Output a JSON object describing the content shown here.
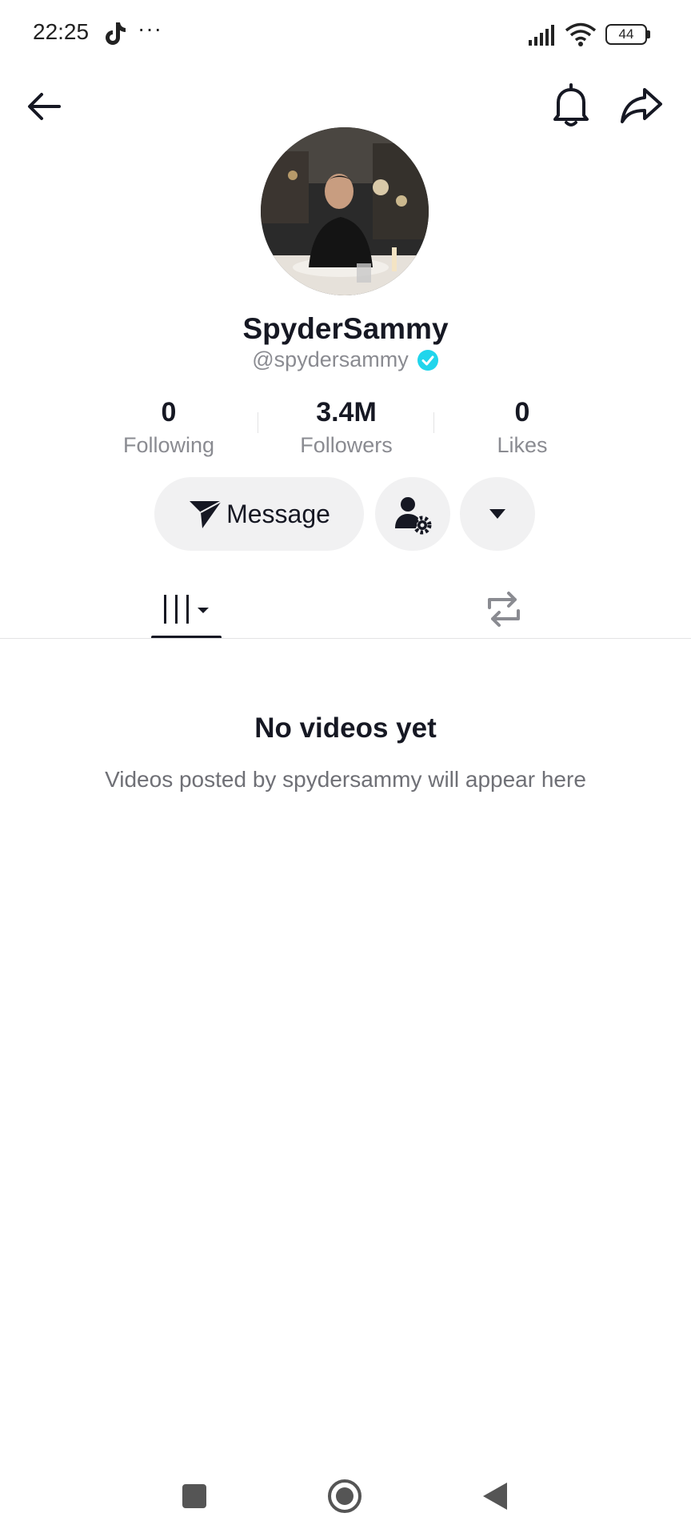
{
  "status_bar": {
    "time": "22:25",
    "overflow": "···",
    "battery": "44",
    "icons": [
      "tiktok-icon",
      "signal-icon",
      "wifi-icon",
      "battery-icon"
    ]
  },
  "header": {
    "icons": [
      "back-arrow-icon",
      "bell-icon",
      "share-icon"
    ]
  },
  "profile": {
    "display_name": "SpyderSammy",
    "handle": "@spydersammy",
    "verified": true
  },
  "stats": {
    "following": {
      "value": "0",
      "label": "Following"
    },
    "followers": {
      "value": "3.4M",
      "label": "Followers"
    },
    "likes": {
      "value": "0",
      "label": "Likes"
    }
  },
  "actions": {
    "message_label": "Message",
    "icons": [
      "send-icon",
      "user-settings-icon",
      "caret-down-icon"
    ]
  },
  "tabs": {
    "items": [
      "videos-grid-tab",
      "reposts-tab"
    ],
    "active": "videos-grid-tab"
  },
  "empty_state": {
    "title": "No videos yet",
    "subtitle": "Videos posted by spydersammy will appear here"
  },
  "nav_bar": {
    "icons": [
      "recents-square-icon",
      "home-circle-icon",
      "back-triangle-icon"
    ]
  },
  "colors": {
    "text": "#161823",
    "secondary": "#8a8b91",
    "button_bg": "#f1f1f2",
    "verified": "#20d5ec"
  }
}
